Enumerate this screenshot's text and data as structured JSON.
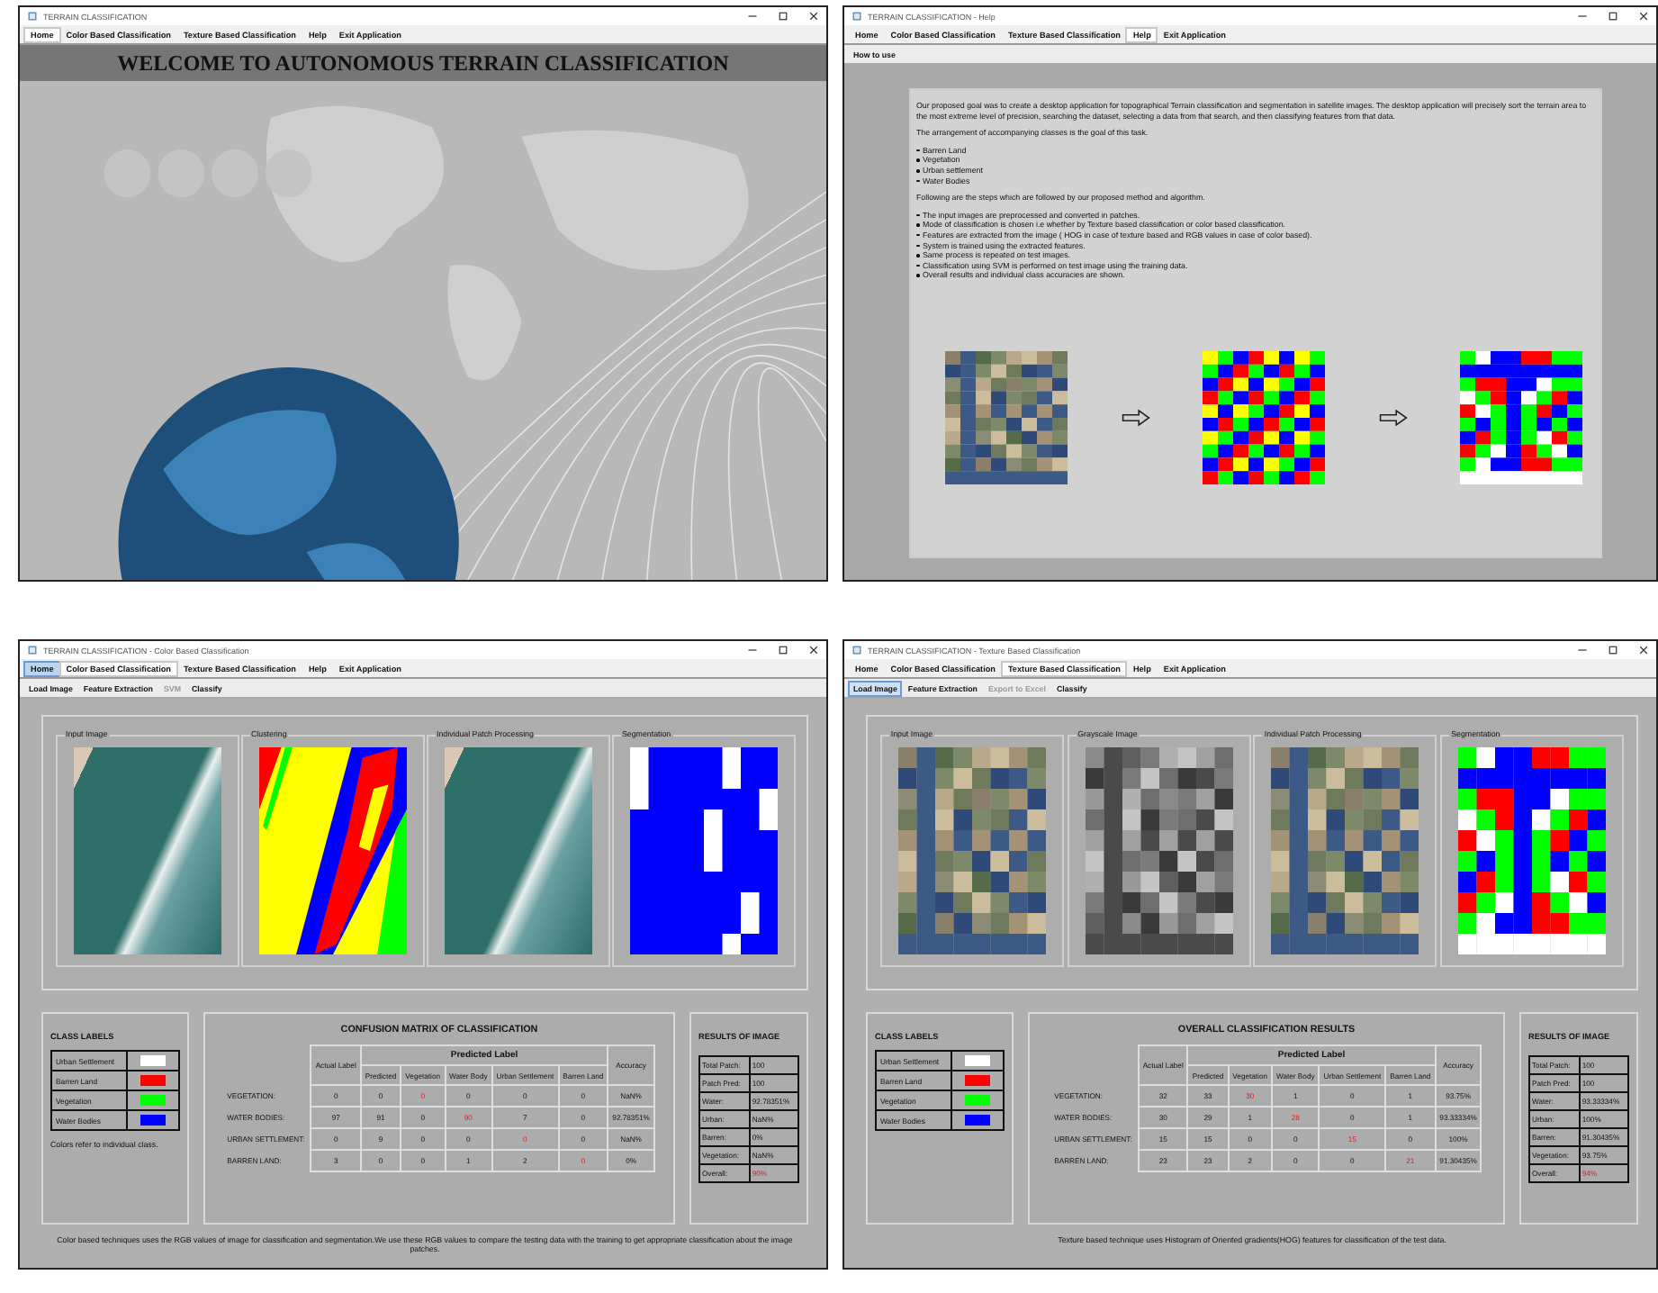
{
  "windows": [
    {
      "kind": "home",
      "title": "TERRAIN CLASSIFICATION",
      "menu": [
        {
          "label": "Home",
          "selected": true,
          "focused": false
        },
        {
          "label": "Color Based Classification",
          "selected": false,
          "focused": false
        },
        {
          "label": "Texture Based Classification",
          "selected": false,
          "focused": false
        },
        {
          "label": "Help",
          "selected": false,
          "focused": false
        },
        {
          "label": "Exit Application",
          "selected": false,
          "focused": false
        }
      ],
      "banner": "WELCOME TO AUTONOMOUS TERRAIN CLASSIFICATION"
    },
    {
      "kind": "help",
      "title": "TERRAIN CLASSIFICATION - Help",
      "menu": [
        {
          "label": "Home",
          "selected": false,
          "focused": false
        },
        {
          "label": "Color Based Classification",
          "selected": false,
          "focused": false
        },
        {
          "label": "Texture Based Classification",
          "selected": false,
          "focused": false
        },
        {
          "label": "Help",
          "selected": true,
          "focused": false
        },
        {
          "label": "Exit Application",
          "selected": false,
          "focused": false
        }
      ],
      "toolbar": [
        {
          "label": "How to use",
          "disabled": false,
          "focused": false
        }
      ],
      "blocks": [
        {
          "kind": "text",
          "text": "Our proposed goal was to create a desktop application for topographical Terrain classification and segmentation in satellite images. The desktop application will precisely sort the terrain area to the most extreme level of precision, searching the dataset, selecting a data from that search, and then classifying features from that data."
        },
        {
          "kind": "text",
          "text": "The arrangement of accompanying classes is the goal of this task."
        },
        {
          "kind": "bullet",
          "text": "Barren Land"
        },
        {
          "kind": "bullet",
          "text": "Vegetation"
        },
        {
          "kind": "bullet",
          "text": "Urban settlement"
        },
        {
          "kind": "bullet",
          "text": "Water Bodies"
        },
        {
          "kind": "text",
          "text": "Following are the steps which are followed by our proposed method and algorithm."
        },
        {
          "kind": "bullet",
          "text": "The input images are preprocessed and converted in patches."
        },
        {
          "kind": "bullet",
          "text": "Mode of classification is chosen i.e whether by Texture based classification or color based classification."
        },
        {
          "kind": "bullet",
          "text": "Features are extracted from the image ( HOG in case of texture based and RGB values in case of color based)."
        },
        {
          "kind": "bullet",
          "text": "System is trained using the extracted features."
        },
        {
          "kind": "bullet",
          "text": "Same process is repeated on test images."
        },
        {
          "kind": "bullet",
          "text": "Classification using SVM is performed on test image using the training data."
        },
        {
          "kind": "bullet",
          "text": "Overall results and individual class accuracies are shown."
        }
      ],
      "figures": [
        {
          "kind": "patches"
        },
        {
          "kind": "cluster_patches"
        },
        {
          "kind": "segmentation"
        }
      ]
    },
    {
      "kind": "classification",
      "title": "TERRAIN CLASSIFICATION - Color Based Classification",
      "menu": [
        {
          "label": "Home",
          "selected": false,
          "focused": true
        },
        {
          "label": "Color Based Classification",
          "selected": true,
          "focused": false
        },
        {
          "label": "Texture Based Classification",
          "selected": false,
          "focused": false
        },
        {
          "label": "Help",
          "selected": false,
          "focused": false
        },
        {
          "label": "Exit Application",
          "selected": false,
          "focused": false
        }
      ],
      "toolbar": [
        {
          "label": "Load Image",
          "disabled": false,
          "focused": false
        },
        {
          "label": "Feature Extraction",
          "disabled": false,
          "focused": false
        },
        {
          "label": "SVM",
          "disabled": true,
          "focused": false
        },
        {
          "label": "Classify",
          "disabled": false,
          "focused": false
        }
      ],
      "panels": [
        {
          "title": "Input Image",
          "kind": "photo"
        },
        {
          "title": "Clustering",
          "kind": "clusters"
        },
        {
          "title": "Individual Patch Processing",
          "kind": "photo"
        },
        {
          "title": "Segmentation",
          "kind": "water_segmentation"
        }
      ],
      "class_labels": {
        "title": "CLASS LABELS",
        "items": [
          {
            "label": "Urban Settlement",
            "color": "#ffffff"
          },
          {
            "label": "Barren Land",
            "color": "#ff0000"
          },
          {
            "label": "Vegetation",
            "color": "#00ff00"
          },
          {
            "label": "Water Bodies",
            "color": "#0000ff"
          }
        ],
        "note": "Colors refer to individual class."
      },
      "matrix": {
        "title": "CONFUSION MATRIX OF CLASSIFICATION",
        "actual_header": "Actual Label",
        "group_header": "Predicted Label",
        "columns": [
          "Predicted",
          "Vegetation",
          "Water Body",
          "Urban Settlement",
          "Barren Land"
        ],
        "accuracy_header": "Accuracy",
        "rows": [
          {
            "label": "VEGETATION:",
            "actual": "0",
            "cells": [
              {
                "value": "0",
                "highlighted": false
              },
              {
                "value": "0",
                "highlighted": true
              },
              {
                "value": "0",
                "highlighted": false
              },
              {
                "value": "0",
                "highlighted": false
              },
              {
                "value": "0",
                "highlighted": false
              }
            ],
            "accuracy": "NaN%"
          },
          {
            "label": "WATER BODIES:",
            "actual": "97",
            "cells": [
              {
                "value": "91",
                "highlighted": false
              },
              {
                "value": "0",
                "highlighted": false
              },
              {
                "value": "90",
                "highlighted": true
              },
              {
                "value": "7",
                "highlighted": false
              },
              {
                "value": "0",
                "highlighted": false
              }
            ],
            "accuracy": "92.78351%"
          },
          {
            "label": "URBAN SETTLEMENT:",
            "actual": "0",
            "cells": [
              {
                "value": "9",
                "highlighted": false
              },
              {
                "value": "0",
                "highlighted": false
              },
              {
                "value": "0",
                "highlighted": false
              },
              {
                "value": "0",
                "highlighted": true
              },
              {
                "value": "0",
                "highlighted": false
              }
            ],
            "accuracy": "NaN%"
          },
          {
            "label": "BARREN LAND:",
            "actual": "3",
            "cells": [
              {
                "value": "0",
                "highlighted": false
              },
              {
                "value": "0",
                "highlighted": false
              },
              {
                "value": "1",
                "highlighted": false
              },
              {
                "value": "2",
                "highlighted": false
              },
              {
                "value": "0",
                "highlighted": true
              }
            ],
            "accuracy": "0%"
          }
        ]
      },
      "results": {
        "title": "RESULTS OF IMAGE",
        "rows": [
          {
            "label": "Total Patch:",
            "value": "100",
            "highlighted": false
          },
          {
            "label": "Patch Pred:",
            "value": "100",
            "highlighted": false
          },
          {
            "label": "Water:",
            "value": "92.78351%",
            "highlighted": false
          },
          {
            "label": "Urban:",
            "value": "NaN%",
            "highlighted": false
          },
          {
            "label": "Barren:",
            "value": "0%",
            "highlighted": false
          },
          {
            "label": "Vegetation:",
            "value": "NaN%",
            "highlighted": false
          },
          {
            "label": "Overall:",
            "value": "90%",
            "highlighted": true
          }
        ]
      },
      "footer": "Color based techniques uses the RGB values of image for classification and segmentation.We use these RGB values to compare the testing data with the training to get appropriate classification about the image patches."
    },
    {
      "kind": "classification",
      "title": "TERRAIN CLASSIFICATION - Texture Based Classification",
      "menu": [
        {
          "label": "Home",
          "selected": false,
          "focused": false
        },
        {
          "label": "Color Based Classification",
          "selected": false,
          "focused": false
        },
        {
          "label": "Texture Based Classification",
          "selected": true,
          "focused": false
        },
        {
          "label": "Help",
          "selected": false,
          "focused": false
        },
        {
          "label": "Exit Application",
          "selected": false,
          "focused": false
        }
      ],
      "toolbar": [
        {
          "label": "Load Image",
          "disabled": false,
          "focused": true
        },
        {
          "label": "Feature Extraction",
          "disabled": false,
          "focused": false
        },
        {
          "label": "Export to Excel",
          "disabled": true,
          "focused": false
        },
        {
          "label": "Classify",
          "disabled": false,
          "focused": false
        }
      ],
      "panels": [
        {
          "title": "Input Image",
          "kind": "patches"
        },
        {
          "title": "Grayscale Image",
          "kind": "grayscale"
        },
        {
          "title": "Individual Patch Processing",
          "kind": "patches"
        },
        {
          "title": "Segmentation",
          "kind": "segmentation"
        }
      ],
      "class_labels": {
        "title": "CLASS LABELS",
        "items": [
          {
            "label": "Urban Settlement",
            "color": "#ffffff"
          },
          {
            "label": "Barren Land",
            "color": "#ff0000"
          },
          {
            "label": "Vegetation",
            "color": "#00ff00"
          },
          {
            "label": "Water Bodies",
            "color": "#0000ff"
          }
        ]
      },
      "matrix": {
        "title": "OVERALL CLASSIFICATION RESULTS",
        "actual_header": "Actual Label",
        "group_header": "Predicted Label",
        "columns": [
          "Predicted",
          "Vegetation",
          "Water Body",
          "Urban Settlement",
          "Barren Land"
        ],
        "accuracy_header": "Accuracy",
        "rows": [
          {
            "label": "VEGETATION:",
            "actual": "32",
            "cells": [
              {
                "value": "33",
                "highlighted": false
              },
              {
                "value": "30",
                "highlighted": true
              },
              {
                "value": "1",
                "highlighted": false
              },
              {
                "value": "0",
                "highlighted": false
              },
              {
                "value": "1",
                "highlighted": false
              }
            ],
            "accuracy": "93.75%"
          },
          {
            "label": "WATER BODIES:",
            "actual": "30",
            "cells": [
              {
                "value": "29",
                "highlighted": false
              },
              {
                "value": "1",
                "highlighted": false
              },
              {
                "value": "28",
                "highlighted": true
              },
              {
                "value": "0",
                "highlighted": false
              },
              {
                "value": "1",
                "highlighted": false
              }
            ],
            "accuracy": "93.33334%"
          },
          {
            "label": "URBAN SETTLEMENT:",
            "actual": "15",
            "cells": [
              {
                "value": "15",
                "highlighted": false
              },
              {
                "value": "0",
                "highlighted": false
              },
              {
                "value": "0",
                "highlighted": false
              },
              {
                "value": "15",
                "highlighted": true
              },
              {
                "value": "0",
                "highlighted": false
              }
            ],
            "accuracy": "100%"
          },
          {
            "label": "BARREN LAND:",
            "actual": "23",
            "cells": [
              {
                "value": "23",
                "highlighted": false
              },
              {
                "value": "2",
                "highlighted": false
              },
              {
                "value": "0",
                "highlighted": false
              },
              {
                "value": "0",
                "highlighted": false
              },
              {
                "value": "21",
                "highlighted": true
              }
            ],
            "accuracy": "91.30435%"
          }
        ]
      },
      "results": {
        "title": "RESULTS OF IMAGE",
        "rows": [
          {
            "label": "Total Patch:",
            "value": "100",
            "highlighted": false
          },
          {
            "label": "Patch Pred:",
            "value": "100",
            "highlighted": false
          },
          {
            "label": "Water:",
            "value": "93.33334%",
            "highlighted": false
          },
          {
            "label": "Urban:",
            "value": "100%",
            "highlighted": false
          },
          {
            "label": "Barren:",
            "value": "91.30435%",
            "highlighted": false
          },
          {
            "label": "Vegetation:",
            "value": "93.75%",
            "highlighted": false
          },
          {
            "label": "Overall:",
            "value": "94%",
            "highlighted": true
          }
        ]
      },
      "footer": "Texture based technique uses Histogram of Oriented gradients(HOG) features for classification of the test data."
    }
  ]
}
